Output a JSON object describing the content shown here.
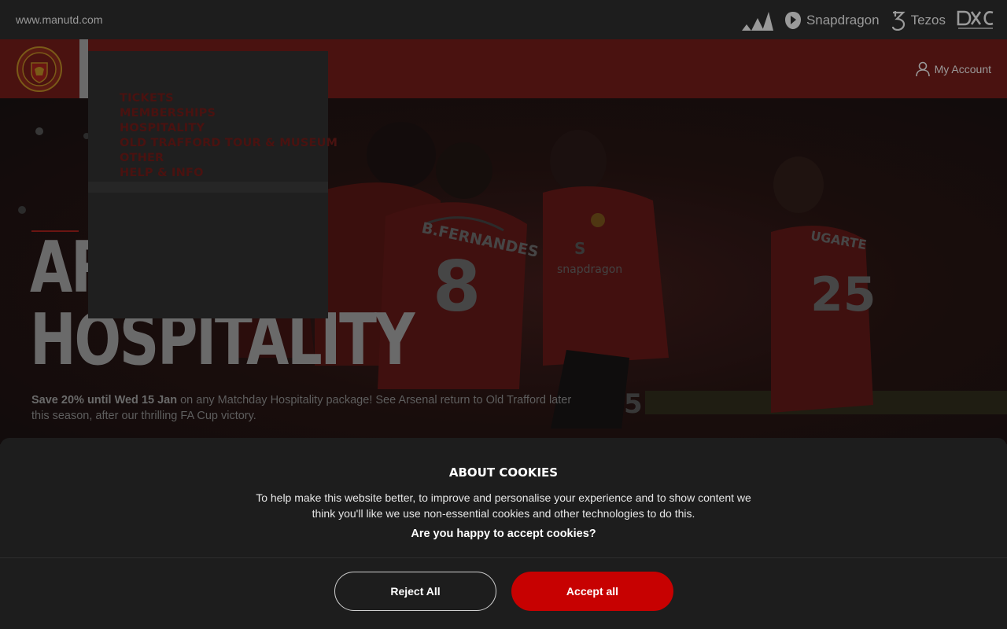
{
  "topbar": {
    "site_url": "www.manutd.com",
    "sponsors": [
      {
        "name": "adidas",
        "label": "",
        "icon": "adidas-stripes-icon"
      },
      {
        "name": "snapdragon",
        "label": "Snapdragon",
        "icon": "snapdragon-icon"
      },
      {
        "name": "tezos",
        "label": "Tezos",
        "icon": "tezos-icon"
      },
      {
        "name": "dxc",
        "label": "DXC",
        "icon": "dxc-icon"
      }
    ]
  },
  "header": {
    "crest_icon": "man-utd-crest-icon",
    "account_label": "My Account",
    "account_icon": "user-icon",
    "colors": {
      "header_red": "#4a1210",
      "brand_red": "#c70101"
    }
  },
  "nav": {
    "items": [
      "TICKETS",
      "MEMBERSHIPS",
      "HOSPITALITY",
      "OLD TRAFFORD TOUR & MUSEUM",
      "OTHER",
      "HELP & INFO"
    ]
  },
  "hero": {
    "title_line1": "AR",
    "title_line2": "HOSPITALITY",
    "sub_bold": "Save 20% until Wed 15 Jan",
    "sub_text": " on any Matchday Hospitality package! See Arsenal return to Old Trafford later this season, after our thrilling FA Cup victory.",
    "image_text": {
      "name_8": "B.FERNANDES",
      "num_8": "8",
      "sponsor": "snapdragon",
      "num_25": "25",
      "name_25": "UGARTE",
      "num_5": "5"
    }
  },
  "cookie": {
    "title": "ABOUT COOKIES",
    "text": "To help make this website better, to improve and personalise your experience and to show content we think you'll like we use non-essential cookies and other technologies to do this.",
    "question": "Are you happy to accept cookies?",
    "reject_label": "Reject All",
    "accept_label": "Accept all"
  }
}
